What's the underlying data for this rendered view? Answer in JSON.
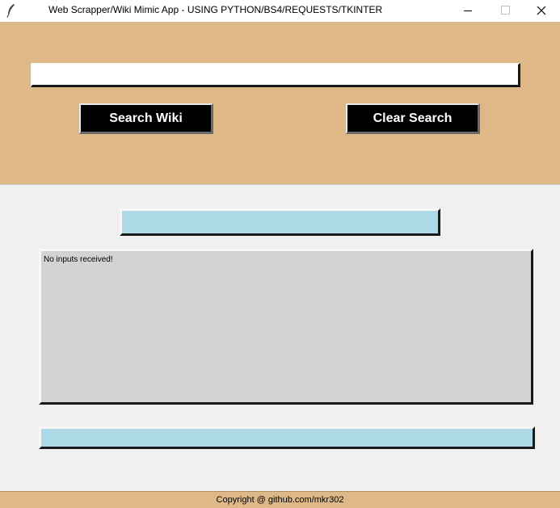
{
  "window": {
    "title": "Web Scrapper/Wiki Mimic App - USING PYTHON/BS4/REQUESTS/TKINTER",
    "icon": "feather-icon"
  },
  "header": {
    "search": {
      "value": "",
      "placeholder": ""
    },
    "search_button_label": "Search Wiki",
    "clear_button_label": "Clear Search"
  },
  "results": {
    "title": "",
    "content": "No inputs received!",
    "link": ""
  },
  "footer": {
    "copyright": "Copyright @ github.com/mkr302"
  },
  "colors": {
    "header_bg": "#deb887",
    "body_bg": "#f0f0f0",
    "button_bg": "#000000",
    "button_text": "#ffffff",
    "title_bar_bg": "#add8e6",
    "content_bg": "#d3d3d3"
  }
}
